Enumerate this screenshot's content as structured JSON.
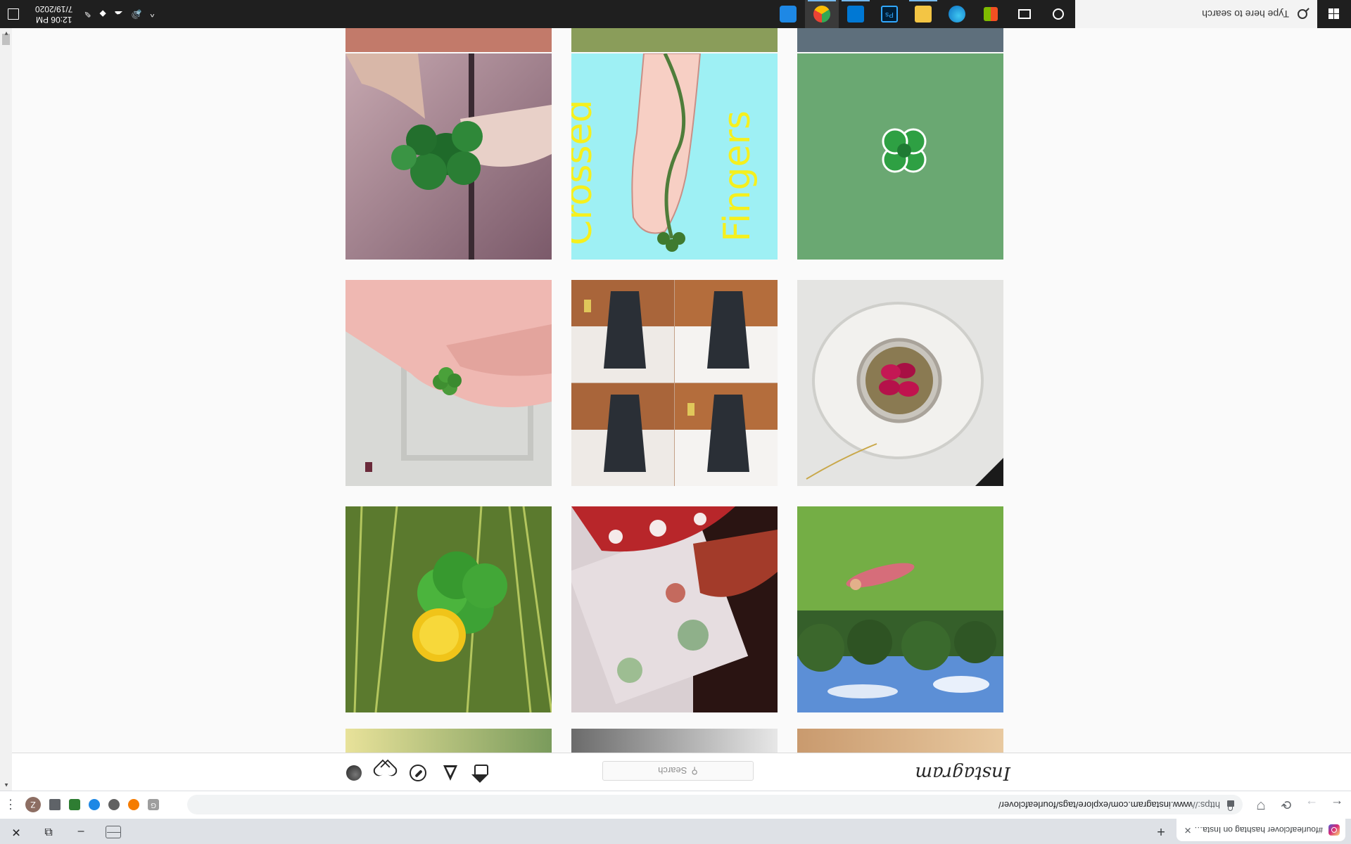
{
  "browser": {
    "tab_title": "#fourleafclover hashtag on Insta…",
    "tab_close": "✕",
    "new_tab": "+",
    "url_scheme": "https://",
    "url_rest": "www.instagram.com/explore/tags/fourleafclover/",
    "profile_initial": "Z",
    "back": "←",
    "forward": "→",
    "reload": "⟳",
    "menu": "⋮",
    "minimize": "–",
    "maximize": "⧉",
    "close": "✕"
  },
  "instagram": {
    "logo": "Instagram",
    "search_placeholder": "Search",
    "search_icon": "⚲",
    "nav_icons": [
      "home-icon",
      "direct-icon",
      "explore-icon",
      "activity-icon",
      "profile-icon"
    ]
  },
  "posts": [
    {
      "id": "grass-sky"
    },
    {
      "id": "mushroom-art"
    },
    {
      "id": "dandelion-clover"
    },
    {
      "id": "red-clover-pendant"
    },
    {
      "id": "chair-collage"
    },
    {
      "id": "hand-clover-door"
    },
    {
      "id": "pixel-clover"
    },
    {
      "id": "crossed-fingers"
    },
    {
      "id": "clover-bunch"
    }
  ],
  "crossed_fingers_text": [
    "Crossed",
    "Fingers"
  ],
  "taskbar": {
    "search_placeholder": "Type here to search",
    "time": "12:06 PM",
    "date": "7/19/2020",
    "tray_chevron": "^"
  },
  "colors": {
    "ig_border": "#dbdbdb",
    "taskbar": "#1f1f1f",
    "chrome_frame": "#dee1e6"
  }
}
